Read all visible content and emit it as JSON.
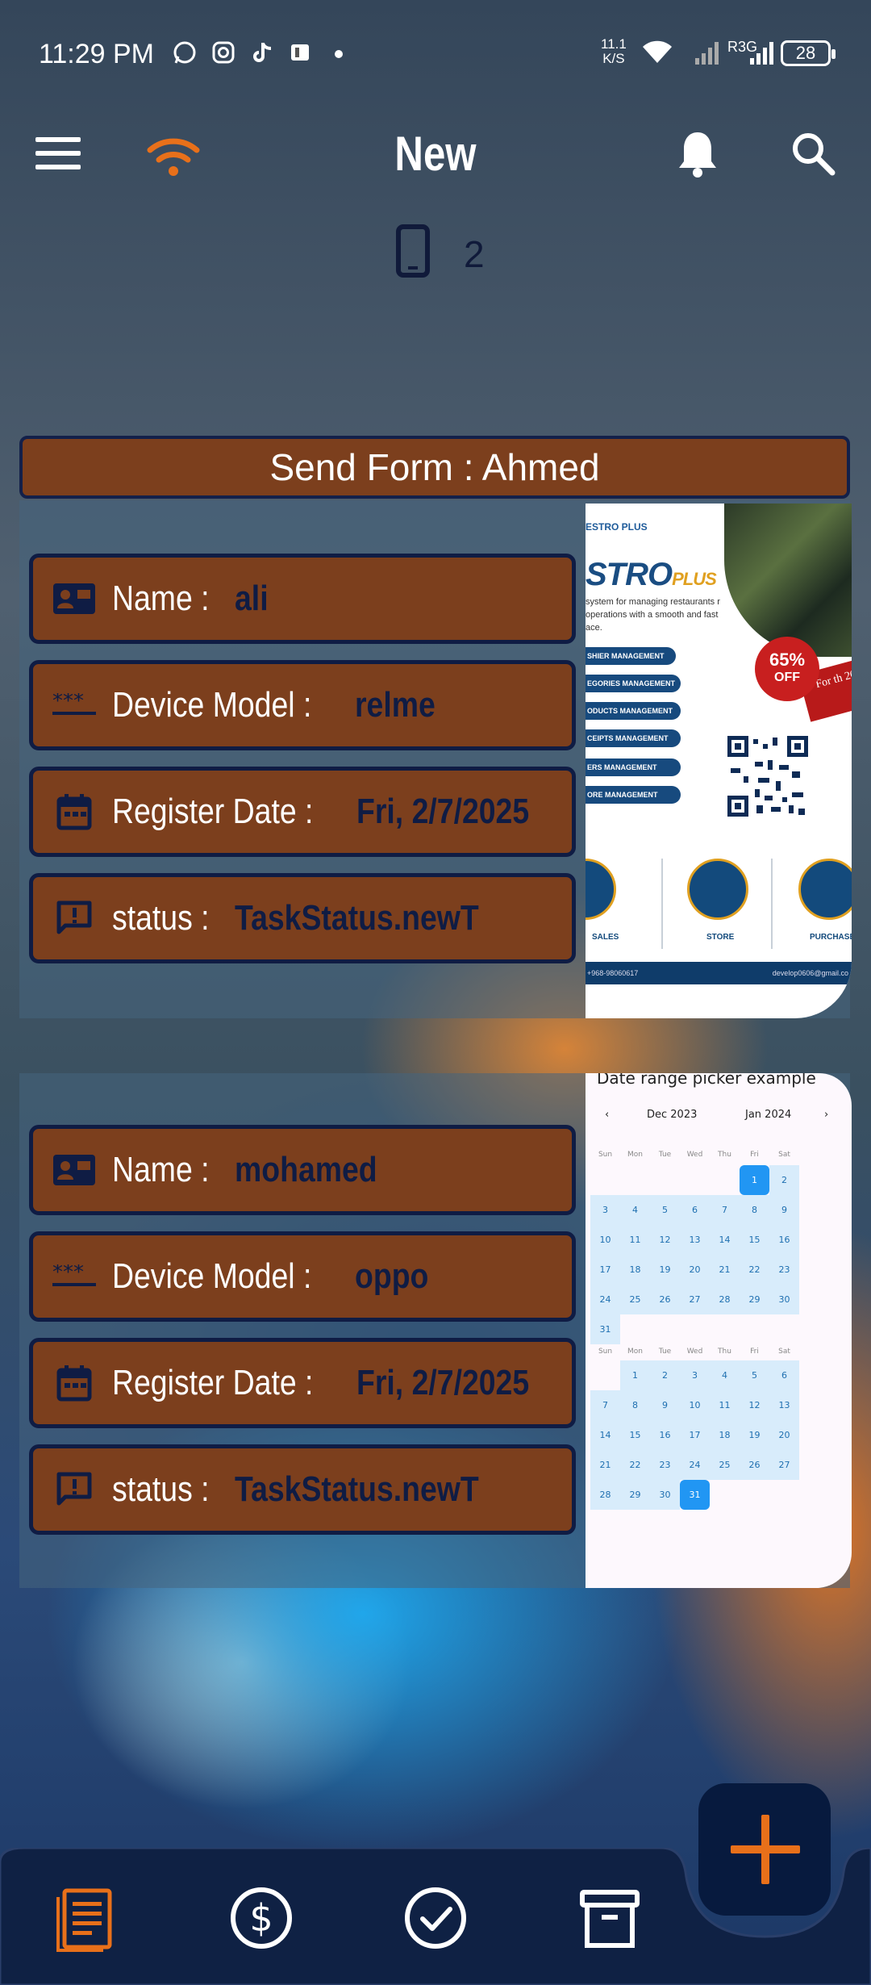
{
  "status_bar": {
    "time": "11:29 PM",
    "net_speed_value": "11.1",
    "net_speed_unit": "K/S",
    "carrier_label": "R3G",
    "battery": "28"
  },
  "app_bar": {
    "title": "New",
    "device_count": "2",
    "icons": [
      "menu-icon",
      "wifi-icon",
      "bell-icon",
      "search-icon"
    ],
    "accent_color": "#e8701a"
  },
  "group_header": {
    "text": "Send Form : Ahmed"
  },
  "cards": [
    {
      "fields": [
        {
          "icon": "contact-card-icon",
          "label": "Name : ",
          "value": "ali"
        },
        {
          "icon": "password-dots-icon",
          "label": "Device Model : ",
          "value": "relme"
        },
        {
          "icon": "calendar-icon",
          "label": "Register Date : ",
          "value": "Fri, 2/7/2025"
        },
        {
          "icon": "alert-message-icon",
          "label": "status : ",
          "value": "TaskStatus.newT"
        }
      ],
      "image": {
        "brand_small": "ESTRO PLUS",
        "brand": "STRO",
        "brand_suffix": "PLUS",
        "tagline": "system for managing restaurants r operations with a smooth and fast ace.",
        "menu_items": [
          "SHIER MANAGEMENT",
          "EGORIES MANAGEMENT",
          "ODUCTS MANAGEMENT",
          "CEIPTS MANAGEMENT",
          "ERS MANAGEMENT",
          "ORE MANAGEMENT"
        ],
        "discount": "65%",
        "discount_label": "OFF",
        "ribbon_text": "For th 20 s",
        "captions": [
          "SALES",
          "STORE",
          "PURCHASES"
        ],
        "footer_phone": "+968-98060617",
        "footer_email": "develop0606@gmail.co"
      }
    },
    {
      "fields": [
        {
          "icon": "contact-card-icon",
          "label": "Name : ",
          "value": "mohamed"
        },
        {
          "icon": "password-dots-icon",
          "label": "Device Model : ",
          "value": "oppo"
        },
        {
          "icon": "calendar-icon",
          "label": "Register Date : ",
          "value": "Fri, 2/7/2025"
        },
        {
          "icon": "alert-message-icon",
          "label": "status : ",
          "value": "TaskStatus.newT"
        }
      ],
      "image": {
        "title": "Date range picker example",
        "month_left": "Dec 2023",
        "month_right": "Jan 2024",
        "weekdays": [
          "Sun",
          "Mon",
          "Tue",
          "Wed",
          "Thu",
          "Fri",
          "Sat"
        ],
        "selected_start": "1",
        "selected_end": "31"
      }
    }
  ],
  "fab": {
    "icon": "plus-icon"
  },
  "bottom_nav": [
    {
      "icon": "document-list-icon",
      "active": true
    },
    {
      "icon": "dollar-circle-icon",
      "active": false
    },
    {
      "icon": "check-circle-icon",
      "active": false
    },
    {
      "icon": "archive-box-icon",
      "active": false
    }
  ]
}
